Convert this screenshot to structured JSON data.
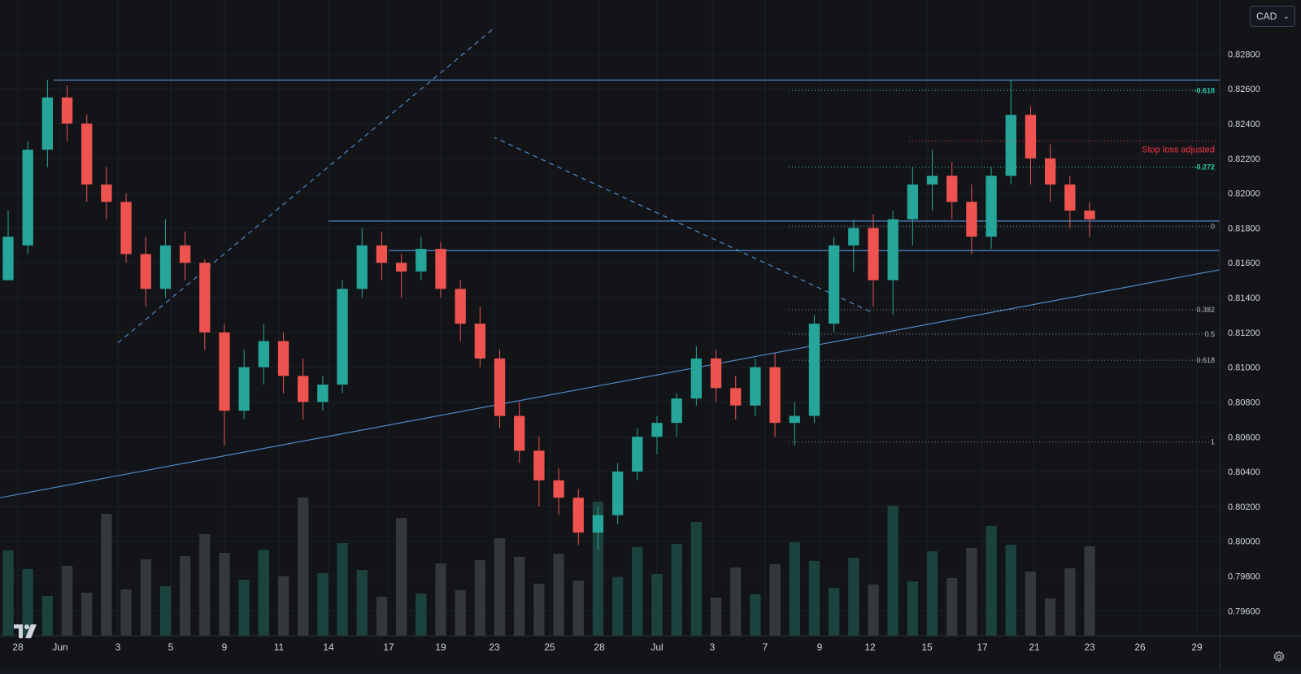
{
  "currency": {
    "label": "CAD",
    "chevron": "⌄"
  },
  "icons": {
    "settings": "gear-icon",
    "logo": "tradingview-logo-icon",
    "dropdown": "chevron-down-icon"
  },
  "colors": {
    "background": "#121417",
    "grid": "#1c2027",
    "up": "#26a69a",
    "down": "#ef5350",
    "line": "#4f8ac9",
    "fib_green": "#2ec4a5",
    "stop": "#f23645",
    "text": "#d1d4dc",
    "muted": "#787b86"
  },
  "chart_data": {
    "type": "candlestick",
    "y_axis": {
      "ticks": [
        "0.82800",
        "0.82600",
        "0.82400",
        "0.82200",
        "0.82000",
        "0.81800",
        "0.81600",
        "0.81400",
        "0.81200",
        "0.81000",
        "0.80800",
        "0.80600",
        "0.80400",
        "0.80200",
        "0.80000",
        "0.79800",
        "0.79600"
      ],
      "range": [
        0.7948,
        0.8304
      ]
    },
    "x_axis": {
      "ticks": [
        "28",
        "Jun",
        "3",
        "5",
        "9",
        "11",
        "14",
        "17",
        "19",
        "23",
        "25",
        "28",
        "Jul",
        "3",
        "7",
        "9",
        "12",
        "15",
        "17",
        "21",
        "23",
        "26",
        "29"
      ]
    },
    "fibonacci_levels": [
      {
        "label": "-0.618",
        "value": 0.8259,
        "highlight": true
      },
      {
        "label": "-0.272",
        "value": 0.8215,
        "highlight": true
      },
      {
        "label": "0",
        "value": 0.8181,
        "highlight": false
      },
      {
        "label": "0.382",
        "value": 0.8133,
        "highlight": false
      },
      {
        "label": "0.5",
        "value": 0.8119,
        "highlight": false
      },
      {
        "label": "0.618",
        "value": 0.8104,
        "highlight": false
      },
      {
        "label": "1",
        "value": 0.8057,
        "highlight": false
      }
    ],
    "annotations": [
      {
        "text": "Stop loss adjusted",
        "value": 0.823,
        "color": "#f23645"
      }
    ],
    "lines": [
      {
        "kind": "horizontal",
        "value": 0.8265,
        "from_date": "Jun",
        "to": "right-edge"
      },
      {
        "kind": "horizontal",
        "value": 0.8184,
        "from_date": "14",
        "to": "right-edge"
      },
      {
        "kind": "horizontal",
        "value": 0.8167,
        "from_date": "17",
        "to": "right-edge"
      },
      {
        "kind": "trendline",
        "from": [
          "28",
          0.8025
        ],
        "to": [
          "29",
          0.8156
        ]
      },
      {
        "kind": "channel-dashed-upper",
        "from": [
          "3",
          0.8114
        ],
        "to": [
          "23",
          0.8295
        ]
      },
      {
        "kind": "channel-dashed-lower",
        "from": [
          "12",
          0.8132
        ],
        "to": [
          "23",
          0.8232
        ]
      }
    ],
    "ohlc_shape": [
      [
        0.815,
        0.819,
        0.8155,
        0.8175
      ],
      [
        0.817,
        0.823,
        0.8165,
        0.8225
      ],
      [
        0.8225,
        0.8265,
        0.8215,
        0.8255
      ],
      [
        0.8255,
        0.8262,
        0.823,
        0.824
      ],
      [
        0.824,
        0.8245,
        0.8195,
        0.8205
      ],
      [
        0.8205,
        0.8215,
        0.8185,
        0.8195
      ],
      [
        0.8195,
        0.82,
        0.816,
        0.8165
      ],
      [
        0.8165,
        0.8175,
        0.8135,
        0.8145
      ],
      [
        0.8145,
        0.8185,
        0.814,
        0.817
      ],
      [
        0.817,
        0.8178,
        0.815,
        0.816
      ],
      [
        0.816,
        0.8162,
        0.811,
        0.812
      ],
      [
        0.812,
        0.8125,
        0.8055,
        0.8075
      ],
      [
        0.8075,
        0.811,
        0.807,
        0.81
      ],
      [
        0.81,
        0.8125,
        0.809,
        0.8115
      ],
      [
        0.8115,
        0.812,
        0.8085,
        0.8095
      ],
      [
        0.8095,
        0.8105,
        0.807,
        0.808
      ],
      [
        0.808,
        0.8095,
        0.8075,
        0.809
      ],
      [
        0.809,
        0.815,
        0.8085,
        0.8145
      ],
      [
        0.8145,
        0.818,
        0.814,
        0.817
      ],
      [
        0.817,
        0.8178,
        0.815,
        0.816
      ],
      [
        0.816,
        0.8165,
        0.814,
        0.8155
      ],
      [
        0.8155,
        0.8175,
        0.815,
        0.8168
      ],
      [
        0.8168,
        0.8172,
        0.814,
        0.8145
      ],
      [
        0.8145,
        0.815,
        0.8115,
        0.8125
      ],
      [
        0.8125,
        0.8135,
        0.81,
        0.8105
      ],
      [
        0.8105,
        0.811,
        0.8065,
        0.8072
      ],
      [
        0.8072,
        0.808,
        0.8045,
        0.8052
      ],
      [
        0.8052,
        0.806,
        0.802,
        0.8035
      ],
      [
        0.8035,
        0.8042,
        0.8015,
        0.8025
      ],
      [
        0.8025,
        0.803,
        0.7998,
        0.8005
      ],
      [
        0.8005,
        0.802,
        0.7995,
        0.8015
      ],
      [
        0.8015,
        0.8045,
        0.801,
        0.804
      ],
      [
        0.804,
        0.8065,
        0.8035,
        0.806
      ],
      [
        0.806,
        0.8072,
        0.805,
        0.8068
      ],
      [
        0.8068,
        0.8085,
        0.806,
        0.8082
      ],
      [
        0.8082,
        0.8112,
        0.8078,
        0.8105
      ],
      [
        0.8105,
        0.811,
        0.808,
        0.8088
      ],
      [
        0.8088,
        0.8095,
        0.807,
        0.8078
      ],
      [
        0.8078,
        0.8105,
        0.8072,
        0.81
      ],
      [
        0.81,
        0.8108,
        0.806,
        0.8068
      ],
      [
        0.8068,
        0.808,
        0.8055,
        0.8072
      ],
      [
        0.8072,
        0.813,
        0.8068,
        0.8125
      ],
      [
        0.8125,
        0.8175,
        0.812,
        0.817
      ],
      [
        0.817,
        0.8185,
        0.8155,
        0.818
      ],
      [
        0.818,
        0.8188,
        0.8135,
        0.815
      ],
      [
        0.815,
        0.819,
        0.813,
        0.8185
      ],
      [
        0.8185,
        0.8215,
        0.817,
        0.8205
      ],
      [
        0.8205,
        0.8225,
        0.819,
        0.821
      ],
      [
        0.821,
        0.8218,
        0.8185,
        0.8195
      ],
      [
        0.8195,
        0.8205,
        0.8165,
        0.8175
      ],
      [
        0.8175,
        0.8215,
        0.8168,
        0.821
      ],
      [
        0.821,
        0.8265,
        0.8205,
        0.8245
      ],
      [
        0.8245,
        0.825,
        0.8205,
        0.822
      ],
      [
        0.822,
        0.8228,
        0.8195,
        0.8205
      ],
      [
        0.8205,
        0.821,
        0.818,
        0.819
      ],
      [
        0.819,
        0.8195,
        0.8175,
        0.8185
      ]
    ],
    "ohlc_note": "approximate shape traced from the image"
  }
}
